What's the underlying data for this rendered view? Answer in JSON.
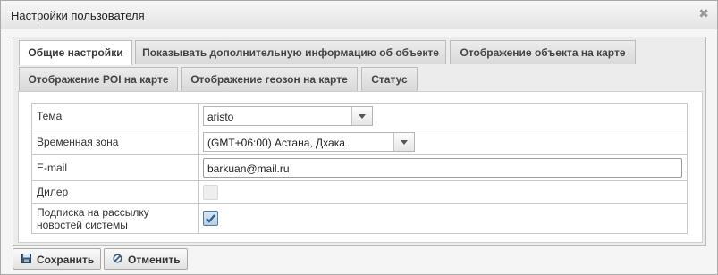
{
  "dialog": {
    "title": "Настройки пользователя",
    "close_icon": "close-icon"
  },
  "tabs": [
    {
      "label": "Общие настройки",
      "active": true
    },
    {
      "label": "Показывать дополнительную информацию об объекте",
      "active": false
    },
    {
      "label": "Отображение объекта на карте",
      "active": false
    },
    {
      "label": "Отображение POI на карте",
      "active": false
    },
    {
      "label": "Отображение геозон на карте",
      "active": false
    },
    {
      "label": "Статус",
      "active": false
    }
  ],
  "form": {
    "theme": {
      "label": "Тема",
      "value": "aristo"
    },
    "timezone": {
      "label": "Временная зона",
      "value": "(GMT+06:00) Астана, Дхака"
    },
    "email": {
      "label": "E-mail",
      "value": "barkuan@mail.ru"
    },
    "dealer": {
      "label": "Дилер",
      "checked": false,
      "disabled": true
    },
    "newsletter": {
      "label_line1": "Подписка на рассылку",
      "label_line2": "новостей системы",
      "checked": true
    }
  },
  "buttons": {
    "save": {
      "label": "Сохранить",
      "icon": "save-icon"
    },
    "cancel": {
      "label": "Отменить",
      "icon": "cancel-icon"
    }
  },
  "colors": {
    "active_tab_bg": "#ffffff",
    "inactive_tab_bg": "#dcdcdc",
    "checkbox_checked": "#4f7fa8"
  }
}
